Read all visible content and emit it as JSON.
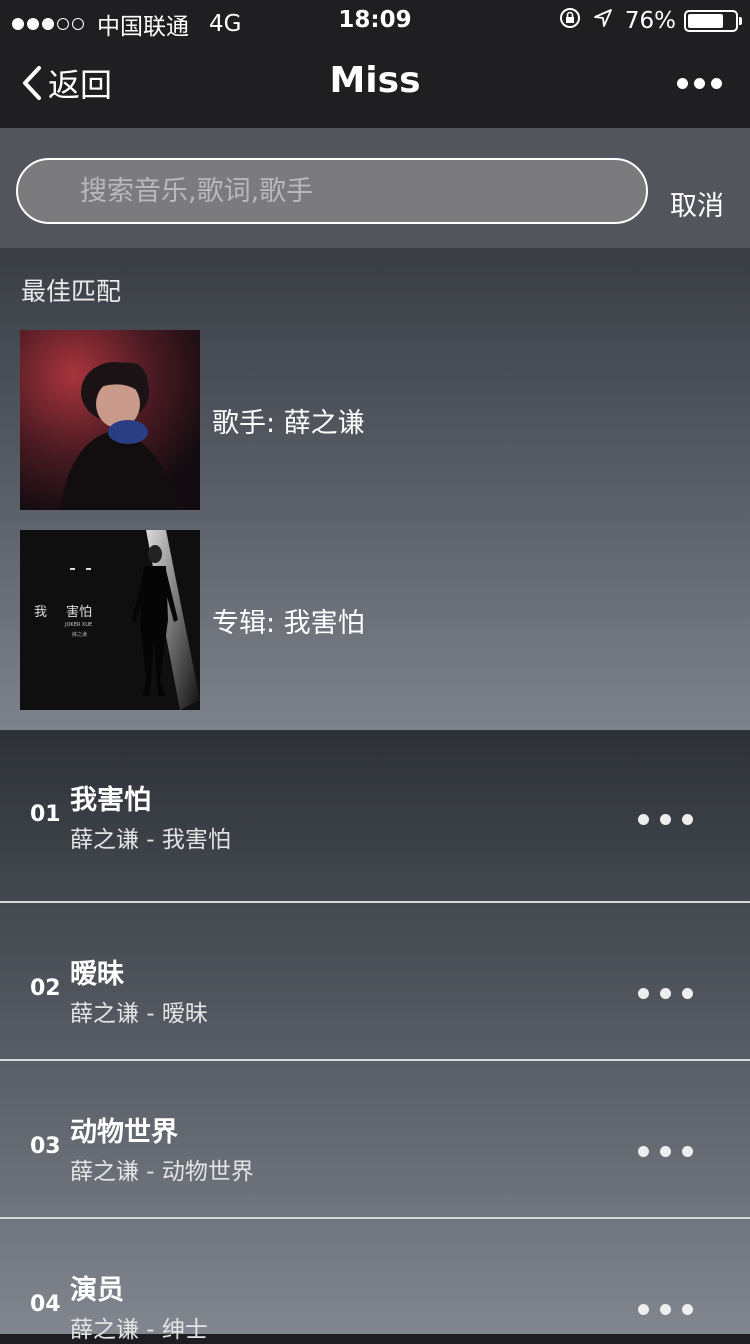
{
  "status_bar": {
    "carrier": "中国联通",
    "network": "4G",
    "time": "18:09",
    "battery_text": "76%",
    "battery_level": 0.76,
    "signal_bars": 3,
    "icons": [
      "orientation-lock-icon",
      "location-arrow-icon",
      "battery-icon"
    ]
  },
  "nav": {
    "back_label": "返回",
    "title": "Miss",
    "more_icon": "more-dots-icon"
  },
  "search": {
    "placeholder": "搜索音乐,歌词,歌手",
    "value": "",
    "cancel_label": "取消"
  },
  "best_match": {
    "title": "最佳匹配",
    "items": [
      {
        "type": "artist",
        "label": "歌手: 薛之谦"
      },
      {
        "type": "album",
        "label": "专辑: 我害怕",
        "cover_text": [
          "我",
          "害怕",
          "JOKER XUE",
          "薛之谦"
        ]
      }
    ]
  },
  "songs": [
    {
      "num": "01",
      "title": "我害怕",
      "subtitle": "薛之谦 - 我害怕"
    },
    {
      "num": "02",
      "title": "暧昧",
      "subtitle": "薛之谦 - 暧昧"
    },
    {
      "num": "03",
      "title": "动物世界",
      "subtitle": "薛之谦 - 动物世界"
    },
    {
      "num": "04",
      "title": "演员",
      "subtitle": "薛之谦 - 绅士"
    }
  ],
  "colors": {
    "nav_bg": "#1f1f21",
    "search_bg": "#52565c",
    "divider": "#d7d9dc"
  }
}
